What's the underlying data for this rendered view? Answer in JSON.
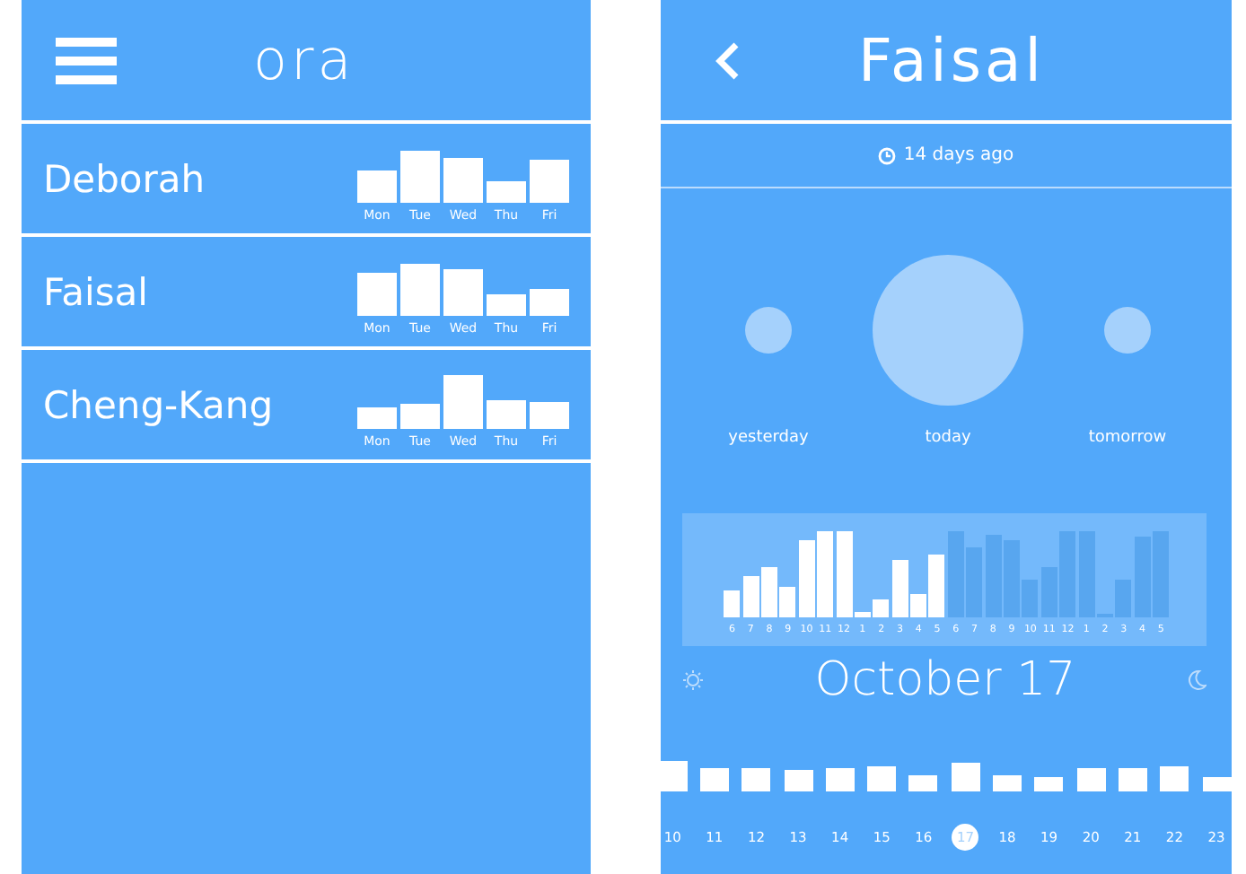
{
  "list_screen": {
    "title": "ora",
    "people": [
      {
        "name": "Deborah",
        "days": [
          "Mon",
          "Tue",
          "Wed",
          "Thu",
          "Fri"
        ]
      },
      {
        "name": "Faisal",
        "days": [
          "Mon",
          "Tue",
          "Wed",
          "Thu",
          "Fri"
        ]
      },
      {
        "name": "Cheng-Kang",
        "days": [
          "Mon",
          "Tue",
          "Wed",
          "Thu",
          "Fri"
        ]
      }
    ]
  },
  "detail_screen": {
    "title": "Faisal",
    "last_seen": "14 days ago",
    "circles": [
      {
        "label": "yesterday"
      },
      {
        "label": "today"
      },
      {
        "label": "tomorrow"
      }
    ],
    "hours": [
      {
        "label": "6",
        "highlighted": true
      },
      {
        "label": "7",
        "highlighted": true
      },
      {
        "label": "8",
        "highlighted": true
      },
      {
        "label": "9",
        "highlighted": true
      },
      {
        "label": "10",
        "highlighted": true
      },
      {
        "label": "11",
        "highlighted": true
      },
      {
        "label": "12",
        "highlighted": true
      },
      {
        "label": "1",
        "highlighted": true
      },
      {
        "label": "2",
        "highlighted": true
      },
      {
        "label": "3",
        "highlighted": true
      },
      {
        "label": "4",
        "highlighted": true
      },
      {
        "label": "5",
        "highlighted": true
      },
      {
        "label": "6",
        "highlighted": false
      },
      {
        "label": "7",
        "highlighted": false
      },
      {
        "label": "8",
        "highlighted": false
      },
      {
        "label": "9",
        "highlighted": false
      },
      {
        "label": "10",
        "highlighted": false
      },
      {
        "label": "11",
        "highlighted": false
      },
      {
        "label": "12",
        "highlighted": false
      },
      {
        "label": "1",
        "highlighted": false
      },
      {
        "label": "2",
        "highlighted": false
      },
      {
        "label": "3",
        "highlighted": false
      },
      {
        "label": "4",
        "highlighted": false
      },
      {
        "label": "5",
        "highlighted": false
      }
    ],
    "date": "October 17",
    "days": [
      {
        "label": "10",
        "selected": false
      },
      {
        "label": "11",
        "selected": false
      },
      {
        "label": "12",
        "selected": false
      },
      {
        "label": "13",
        "selected": false
      },
      {
        "label": "14",
        "selected": false
      },
      {
        "label": "15",
        "selected": false
      },
      {
        "label": "16",
        "selected": false
      },
      {
        "label": "17",
        "selected": true
      },
      {
        "label": "18",
        "selected": false
      },
      {
        "label": "19",
        "selected": false
      },
      {
        "label": "20",
        "selected": false
      },
      {
        "label": "21",
        "selected": false
      },
      {
        "label": "22",
        "selected": false
      },
      {
        "label": "23",
        "selected": false
      }
    ]
  }
}
